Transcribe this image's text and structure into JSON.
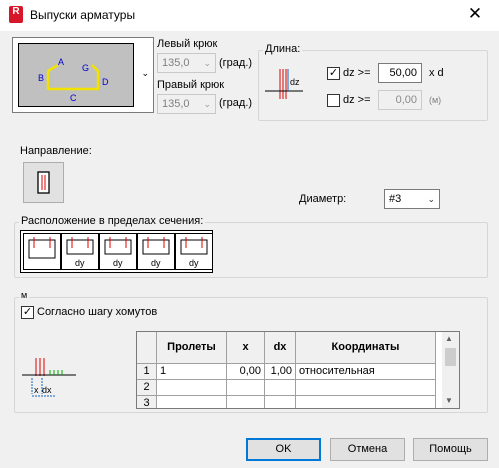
{
  "window": {
    "title": "Выпуски арматуры",
    "close": "✕"
  },
  "hooks": {
    "preview_labels": [
      "A",
      "B",
      "G",
      "C",
      "D"
    ],
    "left_label": "Левый крюк",
    "left_value": "135,0",
    "left_unit": "(град.)",
    "right_label": "Правый крюк",
    "right_value": "135,0",
    "right_unit": "(град.)"
  },
  "length": {
    "title": "Длина:",
    "icon_label": "dz",
    "row1_checked": true,
    "row1_label": "dz >=",
    "row1_value": "50,00",
    "row1_unit": "x d",
    "row2_checked": false,
    "row2_label": "dz >=",
    "row2_value": "0,00",
    "row2_unit": "(м)"
  },
  "direction": {
    "label": "Направление:"
  },
  "diameter": {
    "label": "Диаметр:",
    "value": "#3"
  },
  "location": {
    "label": "Расположение в пределах сечения:",
    "buttons": [
      "",
      "dy",
      "dy",
      "dy",
      "dy"
    ]
  },
  "spacing": {
    "group_label": "м",
    "checkbox_label": "Согласно шагу хомутов",
    "checked": true,
    "icon_labels": [
      "x",
      "dx"
    ]
  },
  "grid": {
    "headers": [
      "Пролеты",
      "x",
      "dx",
      "Координаты"
    ],
    "rows": [
      {
        "num": "1",
        "span": "1",
        "x": "0,00",
        "dx": "1,00",
        "coord": "относительная"
      },
      {
        "num": "2",
        "span": "",
        "x": "",
        "dx": "",
        "coord": ""
      },
      {
        "num": "3",
        "span": "",
        "x": "",
        "dx": "",
        "coord": ""
      }
    ]
  },
  "buttons": {
    "ok": "OK",
    "cancel": "Отмена",
    "help": "Помощь"
  },
  "colors": {
    "accent": "#0078d7",
    "brand": "#d8162a",
    "hook": "#f2e200"
  }
}
